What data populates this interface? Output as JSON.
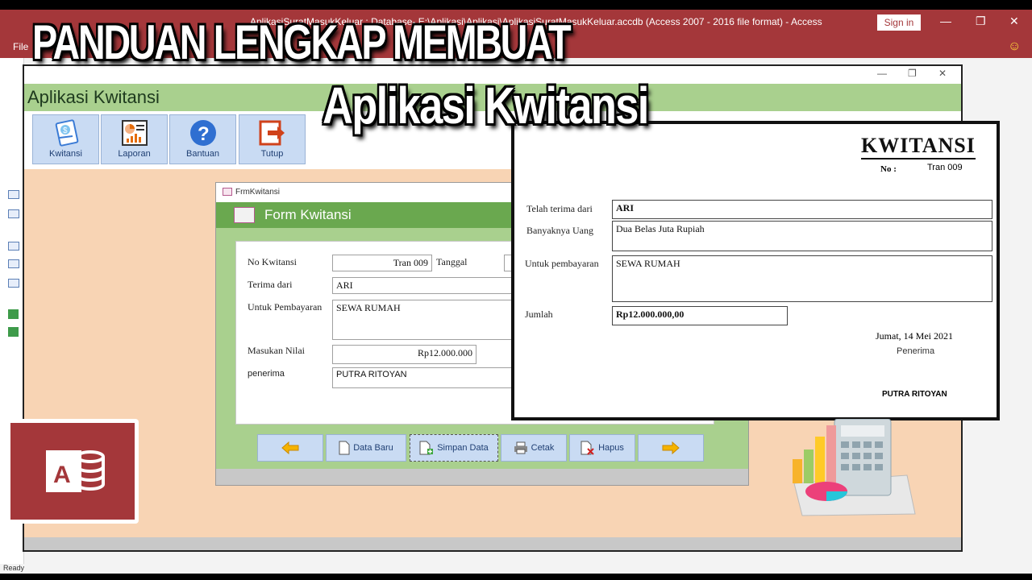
{
  "access": {
    "window_title": "AplikasiSuratMasukKeluar : Database- E:\\Aplikasi\\Aplikasi\\AplikasiSuratMasukKeluar.accdb (Access 2007 - 2016 file format)  -  Access",
    "sign_in": "Sign in",
    "menu_file": "File",
    "status": "Ready"
  },
  "overlay": {
    "headline_line1": "PANDUAN LENGKAP MEMBUAT",
    "headline_line2": "Aplikasi Kwitansi"
  },
  "app": {
    "title": "Aplikasi Kwitansi",
    "toolbar": [
      {
        "label": "Kwitansi",
        "icon": "receipt-icon"
      },
      {
        "label": "Laporan",
        "icon": "report-chart-icon"
      },
      {
        "label": "Bantuan",
        "icon": "help-question-icon"
      },
      {
        "label": "Tutup",
        "icon": "exit-arrow-icon"
      }
    ]
  },
  "form": {
    "window_title": "FrmKwitansi",
    "header": "Form Kwitansi",
    "labels": {
      "no_kwitansi": "No Kwitansi",
      "tanggal": "Tanggal",
      "terima_dari": "Terima dari",
      "untuk_pembayaran": "Untuk Pembayaran",
      "masukan_nilai": "Masukan Nilai",
      "penerima": "penerima"
    },
    "values": {
      "no_kwitansi": "Tran 009",
      "terima_dari": "ARI",
      "untuk_pembayaran": "SEWA RUMAH",
      "masukan_nilai": "Rp12.000.000",
      "penerima": "PUTRA RITOYAN"
    },
    "buttons": {
      "data_baru": "Data Baru",
      "simpan_data": "Simpan Data",
      "cetak": "Cetak",
      "hapus": "Hapus"
    }
  },
  "receipt": {
    "title": "KWITANSI",
    "no_label": "No :",
    "no_value": "Tran 009",
    "labels": {
      "telah_terima": "Telah terima dari",
      "banyaknya_uang": "Banyaknya Uang",
      "untuk_pembayaran": "Untuk pembayaran",
      "jumlah": "Jumlah"
    },
    "values": {
      "telah_terima": "ARI",
      "banyaknya_uang": "Dua Belas Juta Rupiah",
      "untuk_pembayaran": "SEWA RUMAH",
      "jumlah": "Rp12.000.000,00"
    },
    "date": "Jumat, 14 Mei 2021",
    "penerima_label": "Penerima",
    "penerima_name": "PUTRA RITOYAN"
  },
  "colors": {
    "access_red": "#a4373a",
    "app_header_green": "#a9d08e",
    "form_header_green": "#6aa84f",
    "form_background_peach": "#f8d4b4",
    "button_blue": "#c9dbf3"
  }
}
